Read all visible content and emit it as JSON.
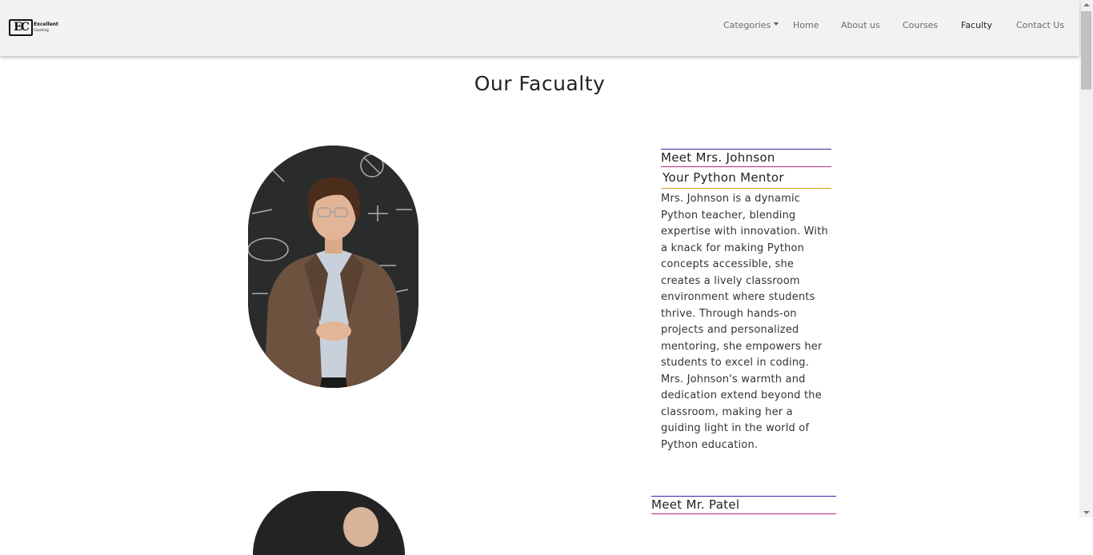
{
  "brand": {
    "logo_mark": "EC",
    "logo_line1": "Excellent",
    "logo_line2": "Coaching"
  },
  "nav": {
    "categories": "Categories",
    "home": "Home",
    "about": "About us",
    "courses": "Courses",
    "faculty": "Faculty",
    "contact": "Contact Us",
    "active": "Faculty"
  },
  "page": {
    "title": "Our Facualty"
  },
  "faculty": [
    {
      "meet": "Meet Mrs. Johnson",
      "role": "Your Python Mentor",
      "bio": "Mrs. Johnson is a dynamic Python teacher, blending expertise with innovation. With a knack for making Python concepts accessible, she creates a lively classroom environment where students thrive. Through hands-on projects and personalized mentoring, she empowers her students to excel in coding. Mrs. Johnson's warmth and dedication extend beyond the classroom, making her a guiding light in the world of Python education.",
      "photo_icon": "teacher-photo"
    },
    {
      "meet": "Meet Mr. Patel",
      "photo_icon": "teacher-photo"
    }
  ],
  "colors": {
    "rule_blue": "#2a2a9c",
    "rule_magenta": "#b0307a",
    "rule_gold": "#d4a017",
    "navbar_bg": "#f2f2f2"
  }
}
